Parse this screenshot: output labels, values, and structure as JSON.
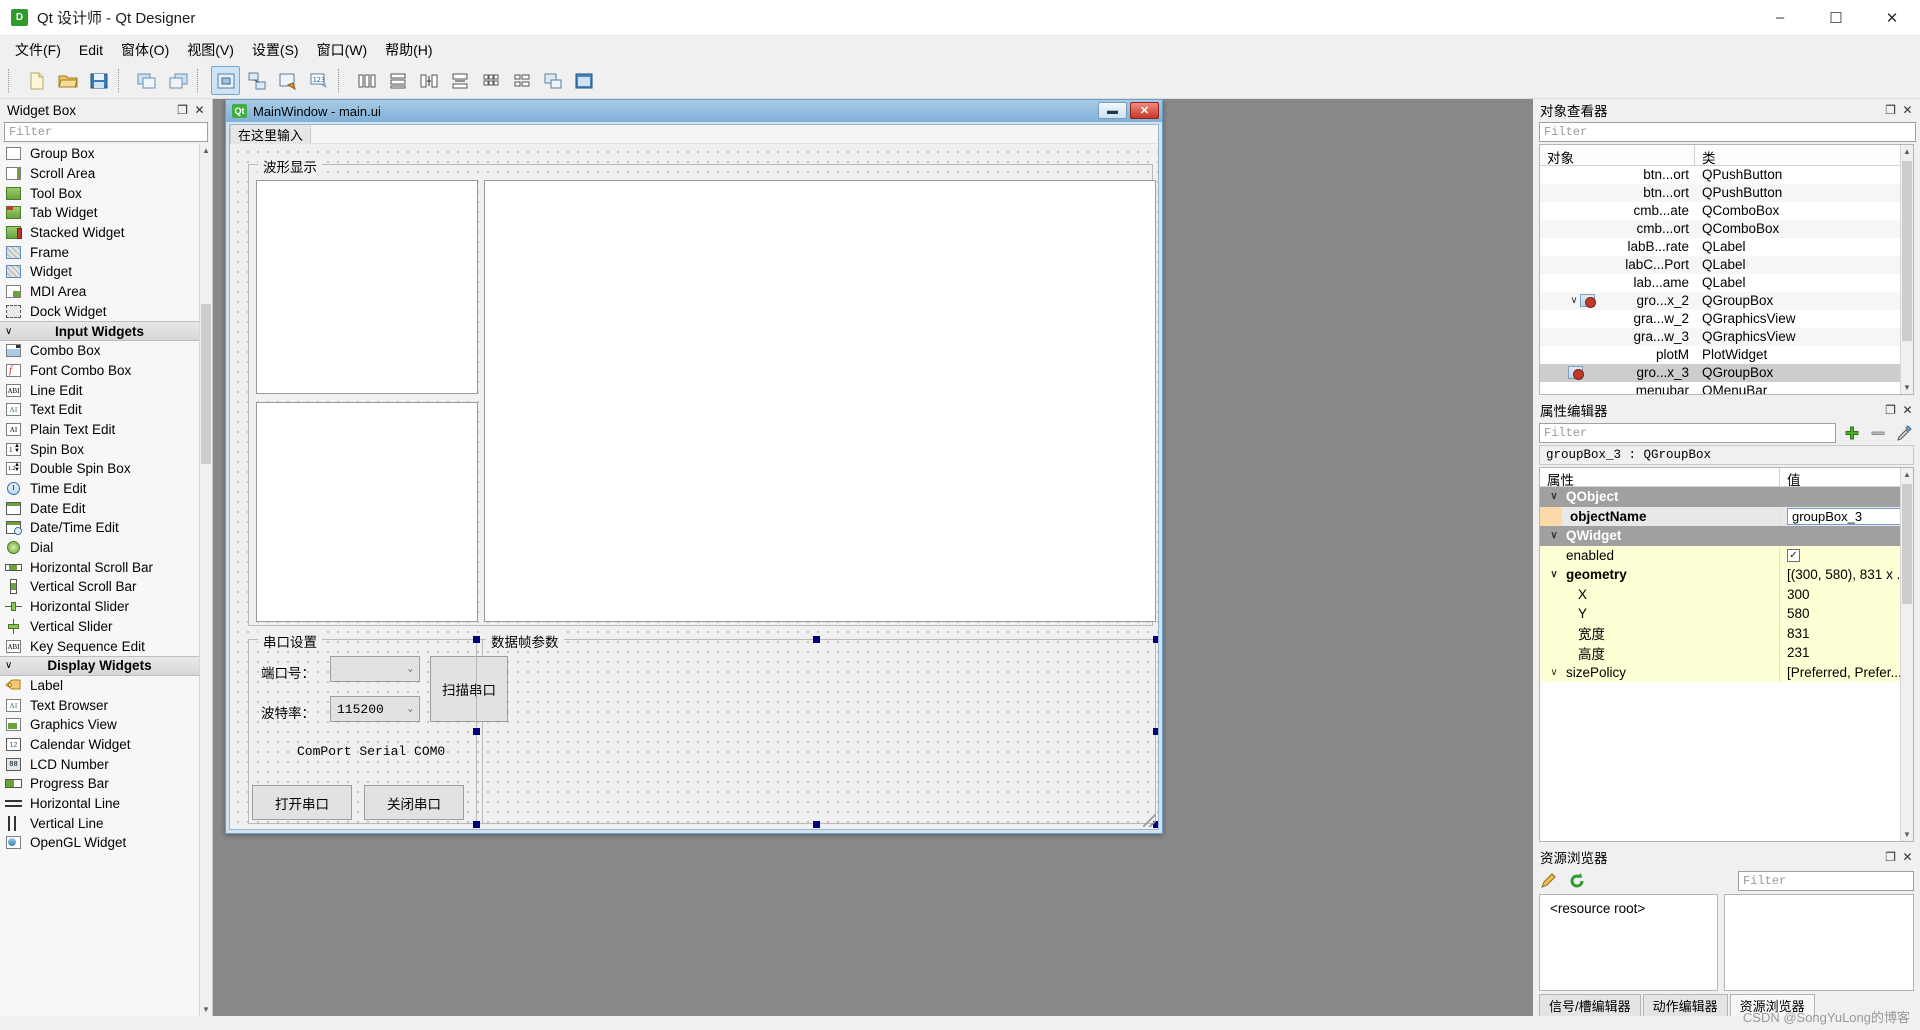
{
  "window": {
    "title": "Qt 设计师 - Qt Designer",
    "icon": "qt-designer-icon",
    "minimize": "–",
    "maximize": "☐",
    "close": "✕"
  },
  "menubar": [
    {
      "label": "文件(F)",
      "name": "menu-file"
    },
    {
      "label": "Edit",
      "name": "menu-edit"
    },
    {
      "label": "窗体(O)",
      "name": "menu-form"
    },
    {
      "label": "视图(V)",
      "name": "menu-view"
    },
    {
      "label": "设置(S)",
      "name": "menu-settings"
    },
    {
      "label": "窗口(W)",
      "name": "menu-window"
    },
    {
      "label": "帮助(H)",
      "name": "menu-help"
    }
  ],
  "toolbar": {
    "groups": [
      [
        "new-form-icon",
        "open-form-icon",
        "save-form-icon"
      ],
      [
        "undo-icon",
        "redo-icon"
      ],
      [
        "edit-widgets-icon",
        "edit-signals-icon",
        "edit-buddies-icon",
        "edit-tab-order-icon"
      ],
      [
        "layout-horizontally-icon",
        "layout-vertically-icon",
        "layout-splitter-h-icon",
        "layout-splitter-v-icon",
        "layout-grid-icon",
        "layout-form-icon",
        "break-layout-icon",
        "adjust-size-icon"
      ]
    ]
  },
  "widget_box": {
    "panel_title": "Widget Box",
    "float_btn": "❐",
    "close_btn": "✕",
    "filter_placeholder": "Filter",
    "items": [
      {
        "label": "Group Box",
        "icon": "group-box-icon",
        "type": "item"
      },
      {
        "label": "Scroll Area",
        "icon": "scroll-area-icon",
        "type": "item"
      },
      {
        "label": "Tool Box",
        "icon": "tool-box-icon",
        "type": "item"
      },
      {
        "label": "Tab Widget",
        "icon": "tab-widget-icon",
        "type": "item"
      },
      {
        "label": "Stacked Widget",
        "icon": "stacked-widget-icon",
        "type": "item"
      },
      {
        "label": "Frame",
        "icon": "frame-icon",
        "type": "item"
      },
      {
        "label": "Widget",
        "icon": "widget-icon",
        "type": "item"
      },
      {
        "label": "MDI Area",
        "icon": "mdi-area-icon",
        "type": "item"
      },
      {
        "label": "Dock Widget",
        "icon": "dock-widget-icon",
        "type": "item"
      },
      {
        "label": "Input Widgets",
        "icon": "chevron-down-icon",
        "type": "group"
      },
      {
        "label": "Combo Box",
        "icon": "combo-box-icon",
        "type": "item"
      },
      {
        "label": "Font Combo Box",
        "icon": "font-combo-box-icon",
        "type": "item"
      },
      {
        "label": "Line Edit",
        "icon": "line-edit-icon",
        "type": "item"
      },
      {
        "label": "Text Edit",
        "icon": "text-edit-icon",
        "type": "item"
      },
      {
        "label": "Plain Text Edit",
        "icon": "plain-text-edit-icon",
        "type": "item"
      },
      {
        "label": "Spin Box",
        "icon": "spin-box-icon",
        "type": "item"
      },
      {
        "label": "Double Spin Box",
        "icon": "double-spin-box-icon",
        "type": "item"
      },
      {
        "label": "Time Edit",
        "icon": "time-edit-icon",
        "type": "item"
      },
      {
        "label": "Date Edit",
        "icon": "date-edit-icon",
        "type": "item"
      },
      {
        "label": "Date/Time Edit",
        "icon": "date-time-edit-icon",
        "type": "item"
      },
      {
        "label": "Dial",
        "icon": "dial-icon",
        "type": "item"
      },
      {
        "label": "Horizontal Scroll Bar",
        "icon": "horizontal-scroll-bar-icon",
        "type": "item"
      },
      {
        "label": "Vertical Scroll Bar",
        "icon": "vertical-scroll-bar-icon",
        "type": "item"
      },
      {
        "label": "Horizontal Slider",
        "icon": "horizontal-slider-icon",
        "type": "item"
      },
      {
        "label": "Vertical Slider",
        "icon": "vertical-slider-icon",
        "type": "item"
      },
      {
        "label": "Key Sequence Edit",
        "icon": "key-sequence-edit-icon",
        "type": "item"
      },
      {
        "label": "Display Widgets",
        "icon": "chevron-down-icon",
        "type": "group"
      },
      {
        "label": "Label",
        "icon": "label-icon",
        "type": "item"
      },
      {
        "label": "Text Browser",
        "icon": "text-browser-icon",
        "type": "item"
      },
      {
        "label": "Graphics View",
        "icon": "graphics-view-icon",
        "type": "item"
      },
      {
        "label": "Calendar Widget",
        "icon": "calendar-widget-icon",
        "type": "item"
      },
      {
        "label": "LCD Number",
        "icon": "lcd-number-icon",
        "type": "item"
      },
      {
        "label": "Progress Bar",
        "icon": "progress-bar-icon",
        "type": "item"
      },
      {
        "label": "Horizontal Line",
        "icon": "horizontal-line-icon",
        "type": "item"
      },
      {
        "label": "Vertical Line",
        "icon": "vertical-line-icon",
        "type": "item"
      },
      {
        "label": "OpenGL Widget",
        "icon": "opengl-widget-icon",
        "type": "item"
      }
    ]
  },
  "form_window": {
    "title": "MainWindow - main.ui",
    "badge": "Qt",
    "minimize": "–",
    "close": "✕",
    "menu_hint": "在这里输入",
    "waveform_group": "波形显示",
    "serial_group": "串口设置",
    "frame_group": "数据帧参数",
    "labels": {
      "port": "端口号：",
      "baud": "波特率："
    },
    "combos": {
      "port_value": "",
      "baud_value": "115200",
      "arrow": "⌄"
    },
    "buttons": {
      "scan": "扫描串口",
      "open": "打开串口",
      "close": "关闭串口"
    },
    "status_text": "ComPort Serial COM0"
  },
  "object_inspector": {
    "panel_title": "对象查看器",
    "float_btn": "❐",
    "close_btn": "✕",
    "filter_placeholder": "Filter",
    "columns": [
      "对象",
      "类"
    ],
    "rows": [
      {
        "name": "btn...ort",
        "class": "QPushButton",
        "indent": 3,
        "expandable": false,
        "selected": false
      },
      {
        "name": "btn...ort",
        "class": "QPushButton",
        "indent": 3,
        "expandable": false,
        "selected": false
      },
      {
        "name": "cmb...ate",
        "class": "QComboBox",
        "indent": 3,
        "expandable": false,
        "selected": false
      },
      {
        "name": "cmb...ort",
        "class": "QComboBox",
        "indent": 3,
        "expandable": false,
        "selected": false
      },
      {
        "name": "labB...rate",
        "class": "QLabel",
        "indent": 3,
        "expandable": false,
        "selected": false
      },
      {
        "name": "labC...Port",
        "class": "QLabel",
        "indent": 3,
        "expandable": false,
        "selected": false
      },
      {
        "name": "lab...ame",
        "class": "QLabel",
        "indent": 3,
        "expandable": false,
        "selected": false
      },
      {
        "name": "gro...x_2",
        "class": "QGroupBox",
        "indent": 2,
        "expandable": true,
        "selected": false
      },
      {
        "name": "gra...w_2",
        "class": "QGraphicsView",
        "indent": 3,
        "expandable": false,
        "selected": false
      },
      {
        "name": "gra...w_3",
        "class": "QGraphicsView",
        "indent": 3,
        "expandable": false,
        "selected": false
      },
      {
        "name": "plotM",
        "class": "PlotWidget",
        "indent": 3,
        "expandable": false,
        "selected": false
      },
      {
        "name": "gro...x_3",
        "class": "QGroupBox",
        "indent": 2,
        "expandable": false,
        "selected": true
      },
      {
        "name": "menubar",
        "class": "QMenuBar",
        "indent": 2,
        "expandable": false,
        "selected": false
      }
    ]
  },
  "property_editor": {
    "panel_title": "属性编辑器",
    "float_btn": "❐",
    "close_btn": "✕",
    "filter_placeholder": "Filter",
    "add_icon": "add-property-icon",
    "remove_icon": "remove-property-icon",
    "configure_icon": "configure-icon",
    "object_line": "groupBox_3 : QGroupBox",
    "columns": [
      "属性",
      "值"
    ],
    "rows": [
      {
        "kind": "group",
        "name": "QObject",
        "value": ""
      },
      {
        "kind": "prop-edit",
        "name": "objectName",
        "value": "groupBox_3",
        "bold": true,
        "swatch": true
      },
      {
        "kind": "group",
        "name": "QWidget",
        "value": ""
      },
      {
        "kind": "prop-check",
        "name": "enabled",
        "value": "✓"
      },
      {
        "kind": "prop-parent",
        "name": "geometry",
        "value": "[(300, 580), 831 x ...",
        "bold": true
      },
      {
        "kind": "prop-child",
        "name": "X",
        "value": "300"
      },
      {
        "kind": "prop-child",
        "name": "Y",
        "value": "580"
      },
      {
        "kind": "prop-child",
        "name": "宽度",
        "value": "831"
      },
      {
        "kind": "prop-child",
        "name": "高度",
        "value": "231"
      },
      {
        "kind": "prop-parent-cut",
        "name": "sizePolicy",
        "value": "[Preferred, Prefer..."
      }
    ]
  },
  "resource_browser": {
    "panel_title": "资源浏览器",
    "float_btn": "❐",
    "close_btn": "✕",
    "edit_icon": "edit-resources-icon",
    "reload_icon": "reload-icon",
    "filter_placeholder": "Filter",
    "tree_root": "<resource root>"
  },
  "bottom_tabs": [
    {
      "label": "信号/槽编辑器",
      "active": false,
      "name": "tab-signal-slot-editor"
    },
    {
      "label": "动作编辑器",
      "active": false,
      "name": "tab-action-editor"
    },
    {
      "label": "资源浏览器",
      "active": true,
      "name": "tab-resource-browser"
    }
  ],
  "watermark": "CSDN @SongYuLong的博客"
}
